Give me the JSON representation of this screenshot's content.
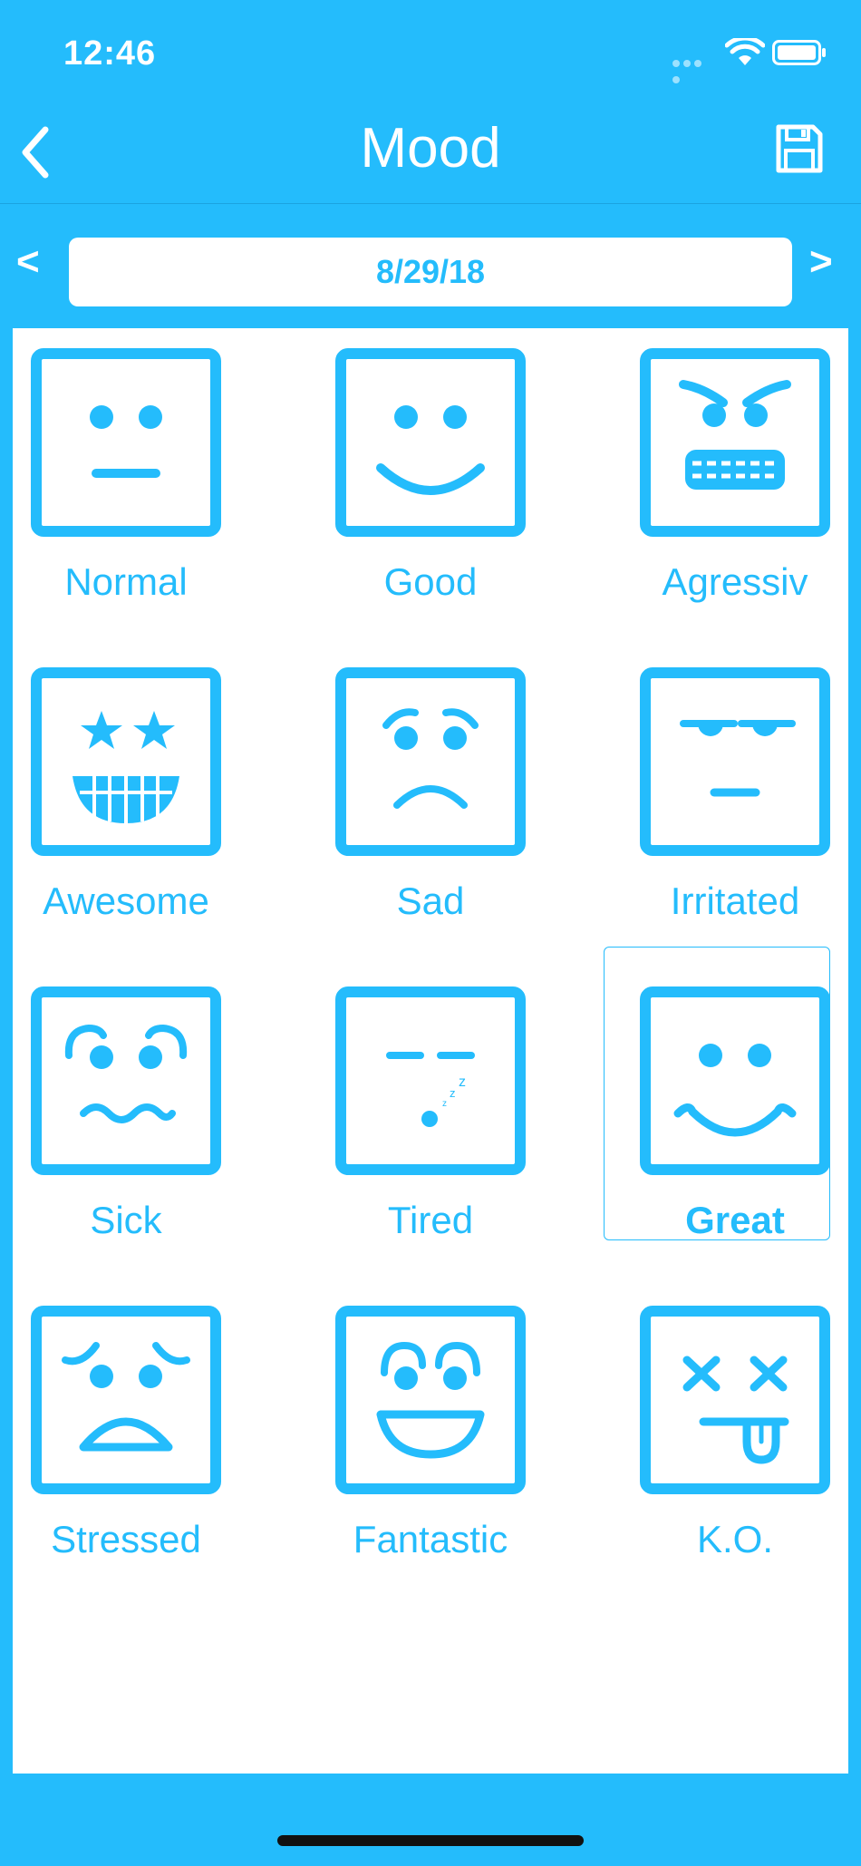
{
  "status": {
    "time": "12:46",
    "wifi_icon": "wifi-icon",
    "battery_icon": "battery-icon"
  },
  "nav": {
    "title": "Mood",
    "back_icon": "chevron-left-icon",
    "save_icon": "floppy-disk-icon"
  },
  "date": {
    "prev": "<",
    "next": ">",
    "value": "8/29/18"
  },
  "colors": {
    "accent": "#24BCFC",
    "panel": "#FFFFFF"
  },
  "moods": [
    {
      "label": "Normal",
      "icon": "normal-face-icon",
      "selected": false
    },
    {
      "label": "Good",
      "icon": "good-face-icon",
      "selected": false
    },
    {
      "label": "Agressiv",
      "icon": "aggressive-face-icon",
      "selected": false
    },
    {
      "label": "Awesome",
      "icon": "awesome-face-icon",
      "selected": false
    },
    {
      "label": "Sad",
      "icon": "sad-face-icon",
      "selected": false
    },
    {
      "label": "Irritated",
      "icon": "irritated-face-icon",
      "selected": false
    },
    {
      "label": "Sick",
      "icon": "sick-face-icon",
      "selected": false
    },
    {
      "label": "Tired",
      "icon": "tired-face-icon",
      "selected": false
    },
    {
      "label": "Great",
      "icon": "great-face-icon",
      "selected": true
    },
    {
      "label": "Stressed",
      "icon": "stressed-face-icon",
      "selected": false
    },
    {
      "label": "Fantastic",
      "icon": "fantastic-face-icon",
      "selected": false
    },
    {
      "label": "K.O.",
      "icon": "ko-face-icon",
      "selected": false
    }
  ]
}
